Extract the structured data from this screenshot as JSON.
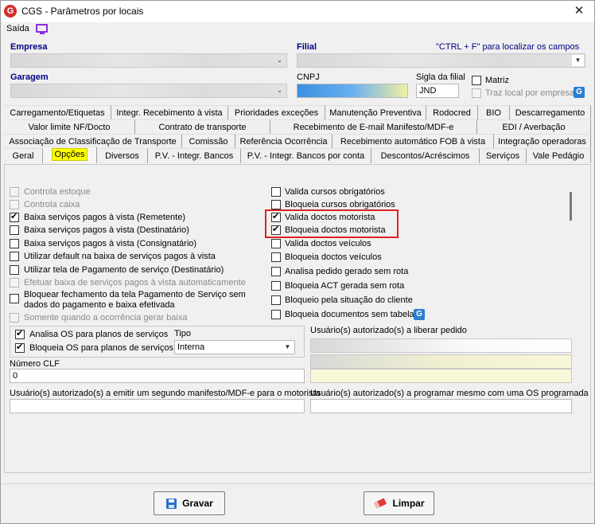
{
  "window": {
    "title": "CGS - Parâmetros por locais",
    "close_glyph": "✕",
    "app_icon_letter": "G"
  },
  "menu": {
    "saida": "Saída"
  },
  "header": {
    "empresa_label": "Empresa",
    "filial_label": "Filial",
    "hint": "\"CTRL + F\" para localizar os campos",
    "garagem_label": "Garagem",
    "cnpj_label": "CNPJ",
    "sigla_label": "Sigla da filial",
    "sigla_value": "JND",
    "matriz_label": "Matriz",
    "traz_local_label": "Traz local por empresa",
    "g_icon_letter": "G"
  },
  "tabs": {
    "row1": [
      "Carregamento/Etiquetas",
      "Integr. Recebimento à vista",
      "Prioridades exceções",
      "Manutenção Preventiva",
      "Rodocred",
      "BIO",
      "Descarregamento"
    ],
    "row2": [
      "Valor limite NF/Docto",
      "Contrato de transporte",
      "Recebimento de E-mail Manifesto/MDF-e",
      "EDI / Averbação"
    ],
    "row3": [
      "Associação de Classificação de Transporte",
      "Comissão",
      "Referência Ocorrência",
      "Recebimento automático FOB à vista",
      "Integração operadoras"
    ],
    "row4": [
      "Geral",
      "Opções",
      "Diversos",
      "P.V. - Integr. Bancos",
      "P.V. - Integr. Bancos por conta",
      "Descontos/Acréscimos",
      "Serviços",
      "Vale Pedágio"
    ]
  },
  "options_left": [
    {
      "label": "Controla estoque",
      "checked": false,
      "disabled": true
    },
    {
      "label": "Controla caixa",
      "checked": false,
      "disabled": true
    },
    {
      "label": "Baixa serviços pagos à vista (Remetente)",
      "checked": true,
      "disabled": false
    },
    {
      "label": "Baixa serviços pagos à vista (Destinatário)",
      "checked": false,
      "disabled": false
    },
    {
      "label": "Baixa serviços pagos à vista (Consignatário)",
      "checked": false,
      "disabled": false
    },
    {
      "label": "Utilizar default na baixa de serviços pagos à vista",
      "checked": false,
      "disabled": false
    },
    {
      "label": "Utilizar tela de Pagamento de serviço (Destinatário)",
      "checked": false,
      "disabled": false
    },
    {
      "label": "Efetuar baixa de serviços pagos à vista automaticamente",
      "checked": false,
      "disabled": true
    },
    {
      "label": "Bloquear fechamento da tela Pagamento de Serviço sem",
      "label2": "dados do pagamento e baixa efetivada",
      "checked": false,
      "disabled": false
    },
    {
      "label": "Somente quando a ocorrência gerar baixa",
      "checked": false,
      "disabled": true
    }
  ],
  "options_right": [
    {
      "label": "Valida cursos obrigatórios",
      "checked": false
    },
    {
      "label": "Bloqueia cursos obrigatórios",
      "checked": false
    },
    {
      "label": "Valida doctos motorista",
      "checked": true
    },
    {
      "label": "Bloqueia doctos motorista",
      "checked": true
    },
    {
      "label": "Valida doctos veículos",
      "checked": false
    },
    {
      "label": "Bloqueia doctos veículos",
      "checked": false
    },
    {
      "label": "Analisa pedido gerado sem rota",
      "checked": false
    },
    {
      "label": "Bloqueia ACT gerada sem rota",
      "checked": false
    },
    {
      "label": "Bloqueio pela situação do cliente",
      "checked": false
    },
    {
      "label": "Bloqueia documentos sem tabela",
      "checked": false
    }
  ],
  "os_group": {
    "analisa_label": "Analisa OS para planos de serviços",
    "bloqueia_label": "Bloqueia OS para planos de serviços",
    "tipo_label": "Tipo",
    "tipo_value": "Interna"
  },
  "numero_clf": {
    "label": "Número CLF",
    "value": "0"
  },
  "usuarios_liberar": {
    "label": "Usuário(s) autorizado(s) a liberar pedido"
  },
  "usuarios_manifesto": {
    "label": "Usuário(s) autorizado(s) a emitir um segundo manifesto/MDF-e para o motorista"
  },
  "usuarios_programar": {
    "label": "Usuário(s) autorizado(s) a programar mesmo com uma OS programada"
  },
  "buttons": {
    "gravar": "Gravar",
    "limpar": "Limpar"
  }
}
